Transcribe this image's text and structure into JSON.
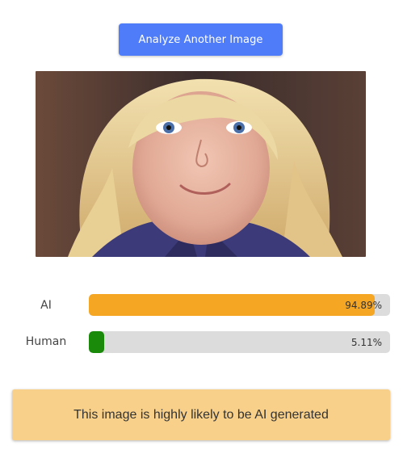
{
  "actions": {
    "analyze_label": "Analyze Another Image"
  },
  "results": [
    {
      "label": "AI",
      "value_text": "94.89%",
      "fraction": 0.9489,
      "color": "#f5a623"
    },
    {
      "label": "Human",
      "value_text": "5.11%",
      "fraction": 0.0511,
      "color": "#1a8a0a"
    }
  ],
  "verdict": {
    "text": "This image is highly likely to be AI generated",
    "color": "#f8d08a"
  },
  "image": {
    "icon": "portrait-photo"
  }
}
